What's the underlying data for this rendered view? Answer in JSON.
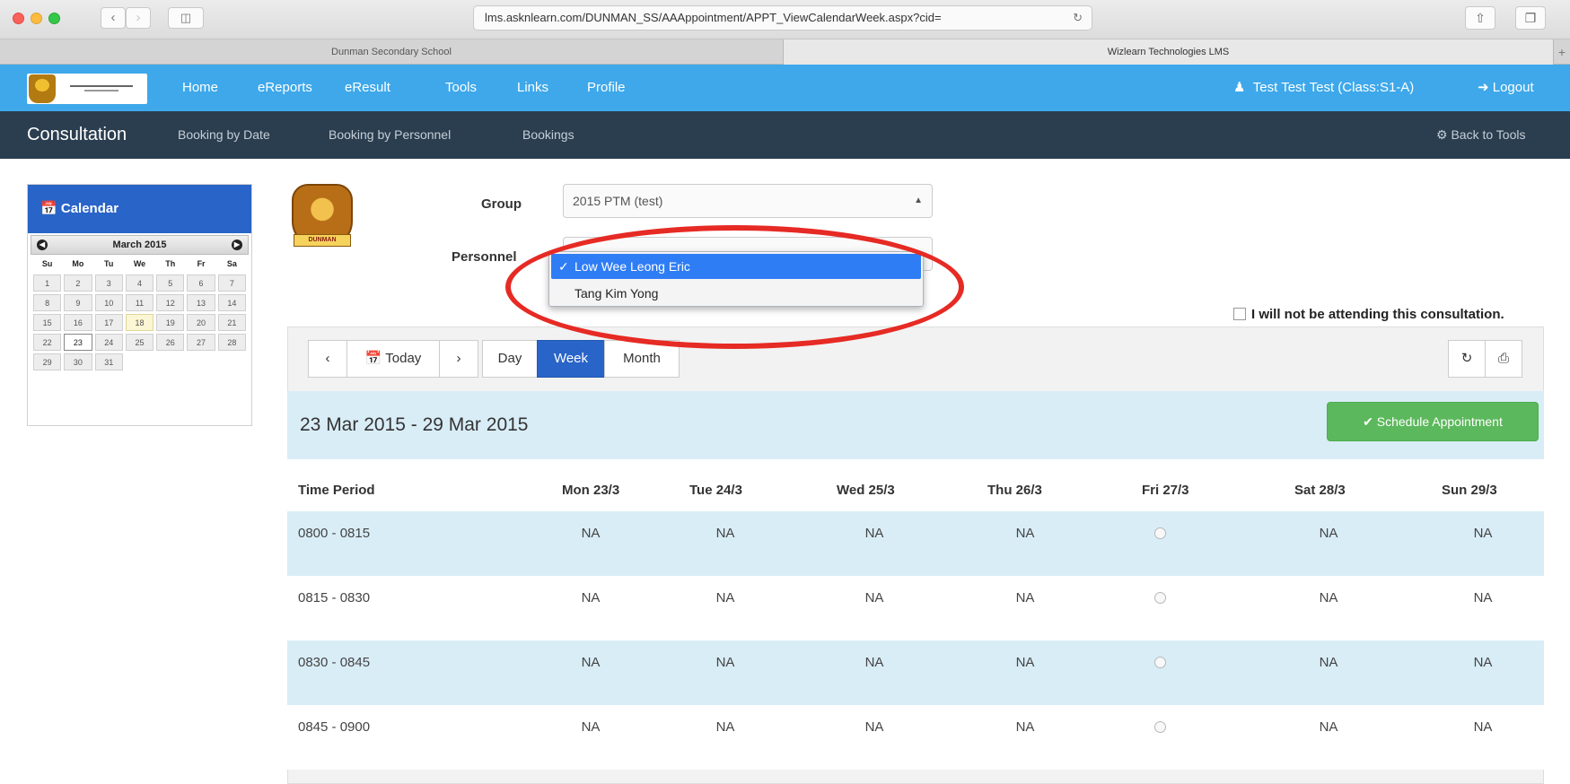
{
  "browser": {
    "url": "lms.asknlearn.com/DUNMAN_SS/AAAppointment/APPT_ViewCalendarWeek.aspx?cid=",
    "tabs": [
      "Dunman Secondary School",
      "Wizlearn Technologies LMS"
    ],
    "back_icon": "‹",
    "forward_icon": "›",
    "new_tab": "+"
  },
  "topnav": {
    "links": [
      "Home",
      "eReports",
      "eResult",
      "Tools",
      "Links",
      "Profile"
    ],
    "user": "Test Test Test (Class:S1-A)",
    "logout": "Logout"
  },
  "subnav": {
    "brand": "Consultation",
    "links": [
      "Booking by Date",
      "Booking by Personnel",
      "Bookings"
    ],
    "back": "Back to Tools"
  },
  "calendar_widget": {
    "title": "Calendar",
    "month": "March 2015",
    "dow": [
      "Su",
      "Mo",
      "Tu",
      "We",
      "Th",
      "Fr",
      "Sa"
    ],
    "days": [
      "1",
      "2",
      "3",
      "4",
      "5",
      "6",
      "7",
      "8",
      "9",
      "10",
      "11",
      "12",
      "13",
      "14",
      "15",
      "16",
      "17",
      "18",
      "19",
      "20",
      "21",
      "22",
      "23",
      "24",
      "25",
      "26",
      "27",
      "28",
      "29",
      "30",
      "31"
    ]
  },
  "crest_text": "DUNMAN",
  "form": {
    "group_label": "Group",
    "group_value": "2015 PTM (test)",
    "personnel_label": "Personnel",
    "options": [
      "Low Wee Leong Eric",
      "Tang Kim Yong"
    ],
    "selected_check": "✓",
    "attend_label": "I will not be attending this consultation."
  },
  "toolbar": {
    "today": "Today",
    "day": "Day",
    "week": "Week",
    "month": "Month",
    "prev": "‹",
    "next": "›",
    "refresh": "↻",
    "print": "⎙"
  },
  "range": "23 Mar 2015 - 29 Mar 2015",
  "schedule_button": "Schedule Appointment",
  "table": {
    "time_header": "Time Period",
    "days": [
      "Mon 23/3",
      "Tue 24/3",
      "Wed 25/3",
      "Thu 26/3",
      "Fri 27/3",
      "Sat 28/3",
      "Sun 29/3"
    ],
    "rows": [
      {
        "time": "0800 - 0815",
        "cells": [
          "NA",
          "NA",
          "NA",
          "NA",
          "",
          "NA",
          "NA"
        ]
      },
      {
        "time": "0815 - 0830",
        "cells": [
          "NA",
          "NA",
          "NA",
          "NA",
          "",
          "NA",
          "NA"
        ]
      },
      {
        "time": "0830 - 0845",
        "cells": [
          "NA",
          "NA",
          "NA",
          "NA",
          "",
          "NA",
          "NA"
        ]
      },
      {
        "time": "0845 - 0900",
        "cells": [
          "NA",
          "NA",
          "NA",
          "NA",
          "",
          "NA",
          "NA"
        ]
      }
    ]
  },
  "colors": {
    "topnav": "#3ea8ea",
    "subnav": "#2b3e50",
    "primary": "#2964c8",
    "success": "#5cb85c",
    "annotation": "#e62a24"
  }
}
